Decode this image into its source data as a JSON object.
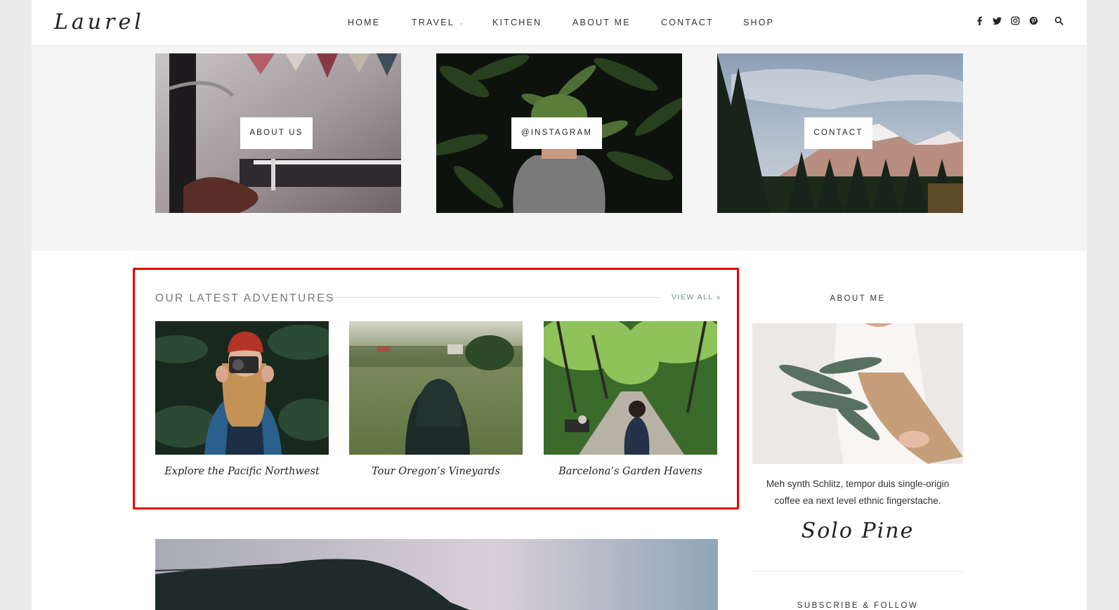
{
  "header": {
    "logo": "Laurel",
    "nav": [
      {
        "label": "HOME"
      },
      {
        "label": "TRAVEL"
      },
      {
        "label": "KITCHEN"
      },
      {
        "label": "ABOUT ME"
      },
      {
        "label": "CONTACT"
      },
      {
        "label": "SHOP"
      }
    ],
    "social": [
      "facebook-icon",
      "twitter-icon",
      "instagram-icon",
      "pinterest-icon",
      "search-icon"
    ]
  },
  "promos": [
    {
      "label": "ABOUT US"
    },
    {
      "label": "@INSTAGRAM"
    },
    {
      "label": "CONTACT"
    }
  ],
  "latest": {
    "title": "OUR LATEST ADVENTURES",
    "view_all": "VIEW ALL »",
    "posts": [
      {
        "title": "Explore the Pacific Northwest"
      },
      {
        "title": "Tour Oregon’s Vineyards"
      },
      {
        "title": "Barcelona’s Garden Havens"
      }
    ]
  },
  "sidebar": {
    "about_title": "ABOUT ME",
    "about_text": "Meh synth Schlitz, tempor duis single-origin coffee ea next level ethnic fingerstache.",
    "signature": "Solo Pine",
    "subscribe_title": "SUBSCRIBE & FOLLOW"
  },
  "colors": {
    "highlight": "#e30000",
    "accent": "#6b8f8d"
  }
}
